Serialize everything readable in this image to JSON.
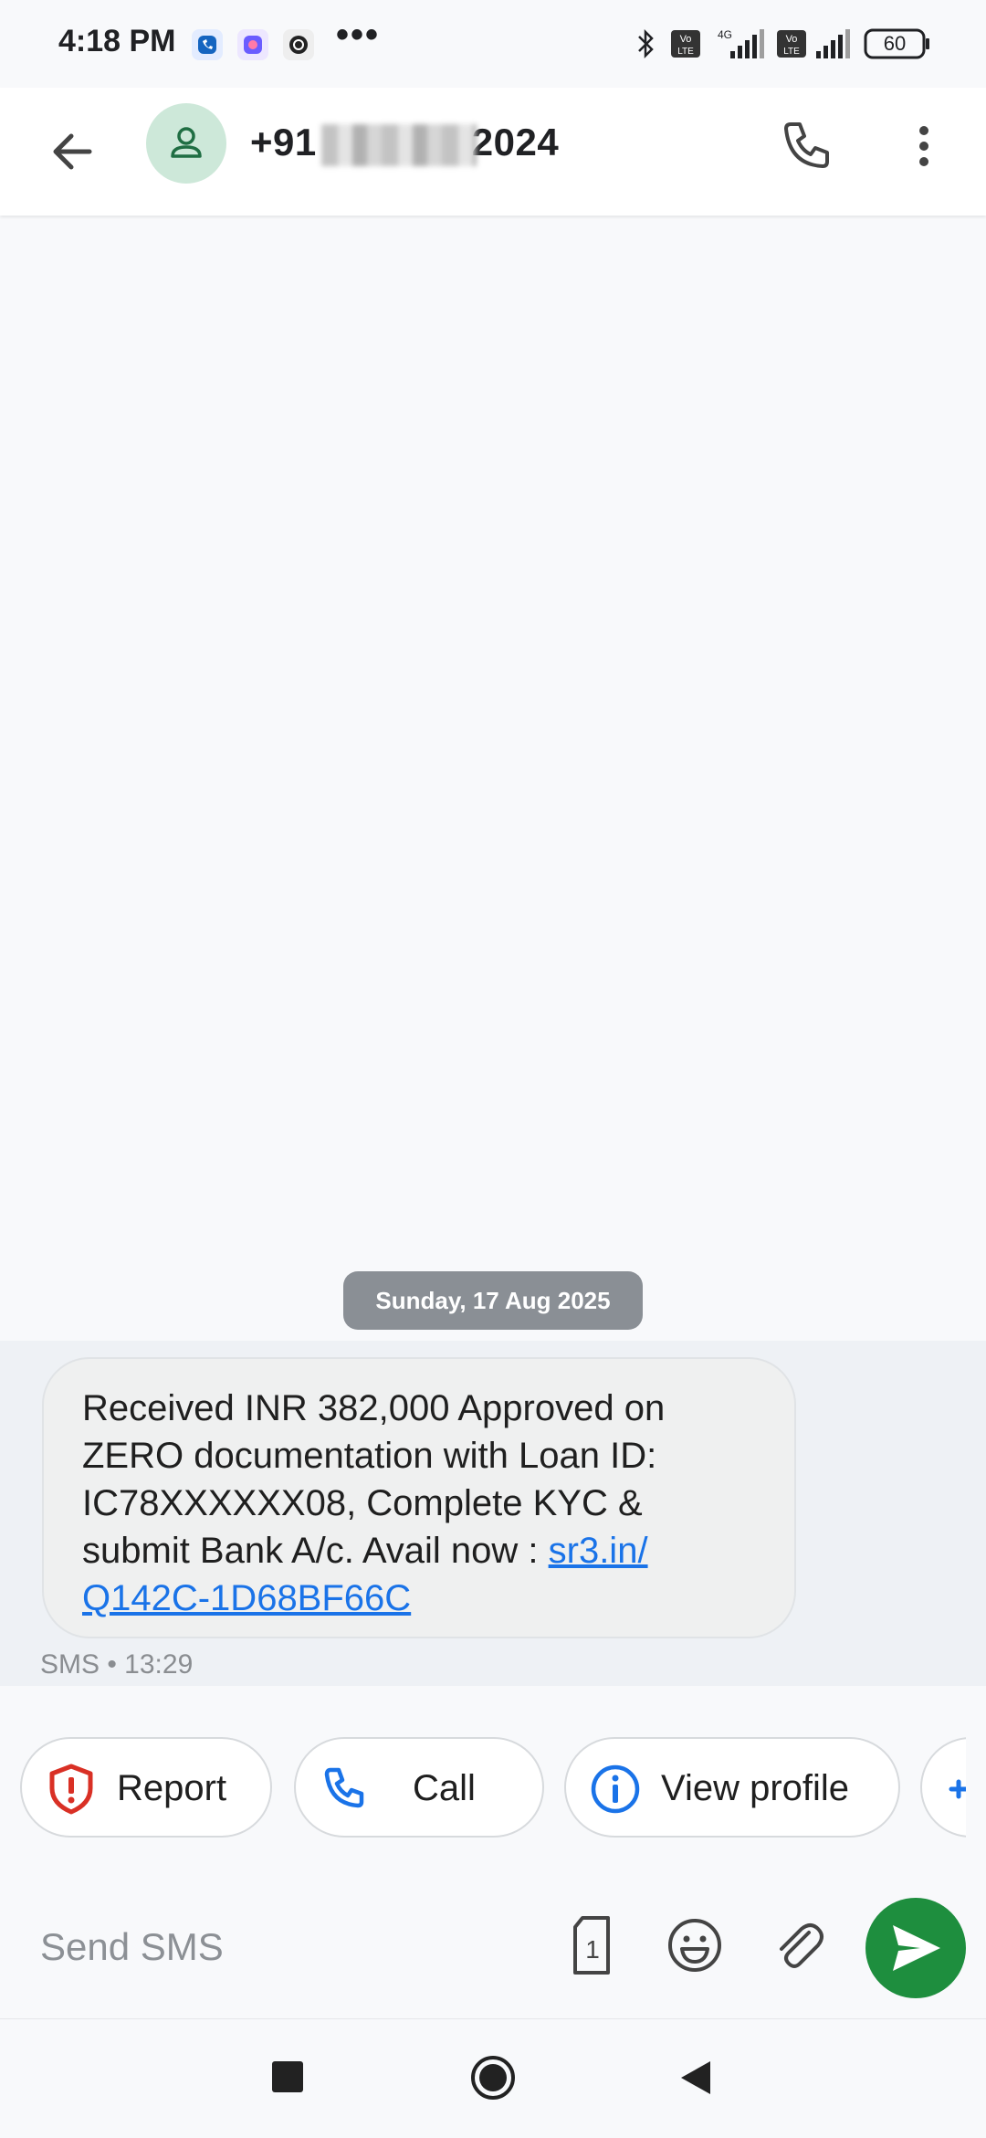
{
  "status_bar": {
    "time": "4:18 PM",
    "more": "•••",
    "battery": "60",
    "notif_icons": [
      "truecaller-icon",
      "gallery-icon",
      "app-icon"
    ],
    "system_icons": [
      "bluetooth-icon",
      "volte-icon",
      "signal-4g-icon",
      "volte-icon",
      "signal-icon",
      "battery-icon"
    ]
  },
  "app_bar": {
    "title": "+91",
    "title_suffix": "2024",
    "back_icon": "arrow-left-icon",
    "avatar_icon": "person-icon",
    "call_icon": "phone-icon",
    "menu_icon": "more-vert-icon"
  },
  "conversation": {
    "date": "Sunday, 17 Aug 2025",
    "message": {
      "text": "Received INR 382,000 Approved on ZERO documentation with Loan ID: IC78XXXXXX08, Complete KYC & submit Bank A/c. Avail now : ",
      "link": "sr3.in/ Q142C-1D68BF66C",
      "meta": "SMS • 13:29"
    }
  },
  "suggestion_chips": [
    {
      "label": "Report",
      "icon": "shield-alert-icon"
    },
    {
      "label": "Call",
      "icon": "phone-icon"
    },
    {
      "label": "View profile",
      "icon": "info-icon"
    },
    {
      "label": "",
      "icon": "add-contact-icon"
    }
  ],
  "compose": {
    "placeholder": "Send SMS",
    "sim_label": "1",
    "icons": [
      "sim-icon",
      "emoji-icon",
      "attach-icon",
      "send-icon"
    ]
  },
  "colors": {
    "accent_green": "#1e8e3e",
    "link_blue": "#1a73e8",
    "report_red": "#d93025",
    "chip_blue": "#1a73e8"
  }
}
